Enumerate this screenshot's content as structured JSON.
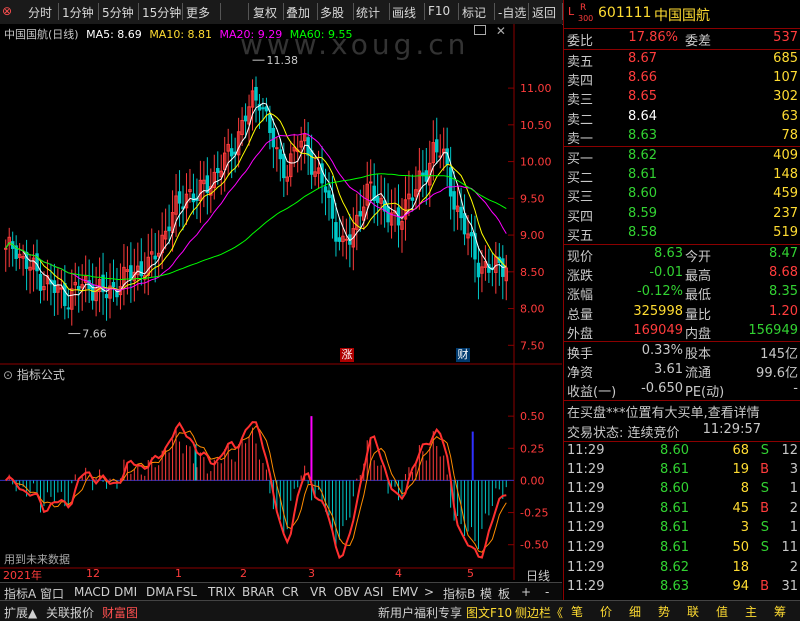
{
  "toolbar": {
    "items": [
      "分时",
      "1分钟",
      "5分钟",
      "15分钟",
      "更多",
      "复权",
      "叠加",
      "多股",
      "统计",
      "画线",
      "F10",
      "标记",
      "-自选",
      "返回"
    ]
  },
  "stock": {
    "code": "601111",
    "name": "中国国航",
    "badge_top": "L",
    "badge_r": "R",
    "badge_num": "300"
  },
  "chart_header": {
    "title": "中国国航(日线)",
    "ma5": "MA5: 8.69",
    "ma10": "MA10: 8.81",
    "ma20": "MA20: 9.29",
    "ma60": "MA60: 9.55",
    "watermark": "www.xoug.cn"
  },
  "main_annotations": {
    "high": "11.38",
    "low": "7.66",
    "tag_zhang": "涨",
    "tag_cai": "财"
  },
  "indicator": {
    "title": "指标公式",
    "footer": "用到未来数据"
  },
  "x_labels": {
    "year": "2021年",
    "m12": "12",
    "m1": "1",
    "m2": "2",
    "m3": "3",
    "m4": "4",
    "m5": "5",
    "period": "日线"
  },
  "tabs": [
    "指标A",
    "窗口",
    "MACD",
    "DMI",
    "DMA",
    "FSL",
    "TRIX",
    "BRAR",
    "CR",
    "VR",
    "OBV",
    "ASI",
    "EMV",
    ">",
    "指标B",
    "模",
    "板",
    "+",
    "-"
  ],
  "statusbar": {
    "left": [
      "扩展▲",
      "关联报价",
      "财富图"
    ],
    "promo": "新用户福利专享",
    "f10": "图文F10",
    "side": "侧边栏《",
    "icons": [
      "笔",
      "价",
      "细",
      "势",
      "联",
      "值",
      "主",
      "筹"
    ]
  },
  "orderbook": {
    "weibi_label": "委比",
    "weibi_val": "17.86%",
    "weicha_label": "委差",
    "weicha_val": "537",
    "sells": [
      {
        "label": "卖五",
        "price": "8.67",
        "vol": "685"
      },
      {
        "label": "卖四",
        "price": "8.66",
        "vol": "107"
      },
      {
        "label": "卖三",
        "price": "8.65",
        "vol": "302"
      },
      {
        "label": "卖二",
        "price": "8.64",
        "vol": "63"
      },
      {
        "label": "卖一",
        "price": "8.63",
        "vol": "78"
      }
    ],
    "buys": [
      {
        "label": "买一",
        "price": "8.62",
        "vol": "409"
      },
      {
        "label": "买二",
        "price": "8.61",
        "vol": "148"
      },
      {
        "label": "买三",
        "price": "8.60",
        "vol": "459"
      },
      {
        "label": "买四",
        "price": "8.59",
        "vol": "237"
      },
      {
        "label": "买五",
        "price": "8.58",
        "vol": "519"
      }
    ]
  },
  "quote": [
    {
      "l1": "现价",
      "v1": "8.63",
      "l2": "今开",
      "v2": "8.47"
    },
    {
      "l1": "涨跌",
      "v1": "-0.01",
      "l2": "最高",
      "v2": "8.68"
    },
    {
      "l1": "涨幅",
      "v1": "-0.12%",
      "l2": "最低",
      "v2": "8.35"
    },
    {
      "l1": "总量",
      "v1": "325998",
      "l2": "量比",
      "v2": "1.20"
    },
    {
      "l1": "外盘",
      "v1": "169049",
      "l2": "内盘",
      "v2": "156949"
    }
  ],
  "fund": [
    {
      "l1": "换手",
      "v1": "0.33%",
      "l2": "股本",
      "v2": "145亿"
    },
    {
      "l1": "净资",
      "v1": "3.61",
      "l2": "流通",
      "v2": "99.6亿"
    },
    {
      "l1": "收益(一)",
      "v1": "-0.650",
      "l2": "PE(动)",
      "v2": "-"
    }
  ],
  "notice": "在买盘***位置有大买单,查看详情",
  "trade_status": {
    "label": "交易状态: 连续竞价",
    "time": "11:29:57"
  },
  "ticks": [
    {
      "t": "11:29",
      "p": "8.60",
      "v": "68",
      "s": "S",
      "n": "12"
    },
    {
      "t": "11:29",
      "p": "8.61",
      "v": "19",
      "s": "B",
      "n": "3"
    },
    {
      "t": "11:29",
      "p": "8.60",
      "v": "8",
      "s": "S",
      "n": "1"
    },
    {
      "t": "11:29",
      "p": "8.61",
      "v": "45",
      "s": "B",
      "n": "2"
    },
    {
      "t": "11:29",
      "p": "8.61",
      "v": "3",
      "s": "S",
      "n": "1"
    },
    {
      "t": "11:29",
      "p": "8.61",
      "v": "50",
      "s": "S",
      "n": "11"
    },
    {
      "t": "11:29",
      "p": "8.62",
      "v": "18",
      "s": "",
      "n": "2"
    },
    {
      "t": "11:29",
      "p": "8.63",
      "v": "94",
      "s": "B",
      "n": "31"
    }
  ],
  "axes": {
    "price_ticks": [
      "11.00",
      "10.50",
      "10.00",
      "9.50",
      "9.00",
      "8.50",
      "8.00",
      "7.50"
    ],
    "ind_ticks": [
      "0.50",
      "0.25",
      "0.00",
      "-0.25",
      "-0.50"
    ]
  },
  "chart_data": {
    "type": "line",
    "candles_close": [
      8.75,
      8.9,
      8.6,
      8.55,
      8.4,
      8.3,
      8.2,
      8.15,
      8.3,
      8.35,
      8.25,
      8.2,
      8.3,
      8.4,
      8.5,
      8.55,
      8.6,
      8.9,
      9.2,
      9.4,
      9.6,
      9.5,
      9.7,
      9.8,
      10.0,
      10.2,
      10.5,
      10.8,
      10.9,
      10.4,
      10.0,
      9.9,
      10.2,
      10.3,
      9.8,
      9.7,
      9.2,
      8.8,
      9.0,
      9.4,
      9.6,
      9.5,
      9.3,
      9.1,
      9.5,
      9.6,
      9.8,
      10.2,
      10.1,
      9.6,
      9.2,
      8.9,
      8.6,
      8.5,
      8.6,
      8.63
    ],
    "ma_series": [
      "MA5",
      "MA10",
      "MA20",
      "MA60"
    ],
    "price_range": [
      7.3,
      11.6
    ],
    "indicator_range": [
      -0.65,
      0.75
    ],
    "colors": {
      "up": "#ff3c3c",
      "down": "#00c8c8",
      "ma5": "#ffffff",
      "ma10": "#ffff00",
      "ma20": "#ff00ff",
      "ma60": "#00ff00"
    }
  }
}
